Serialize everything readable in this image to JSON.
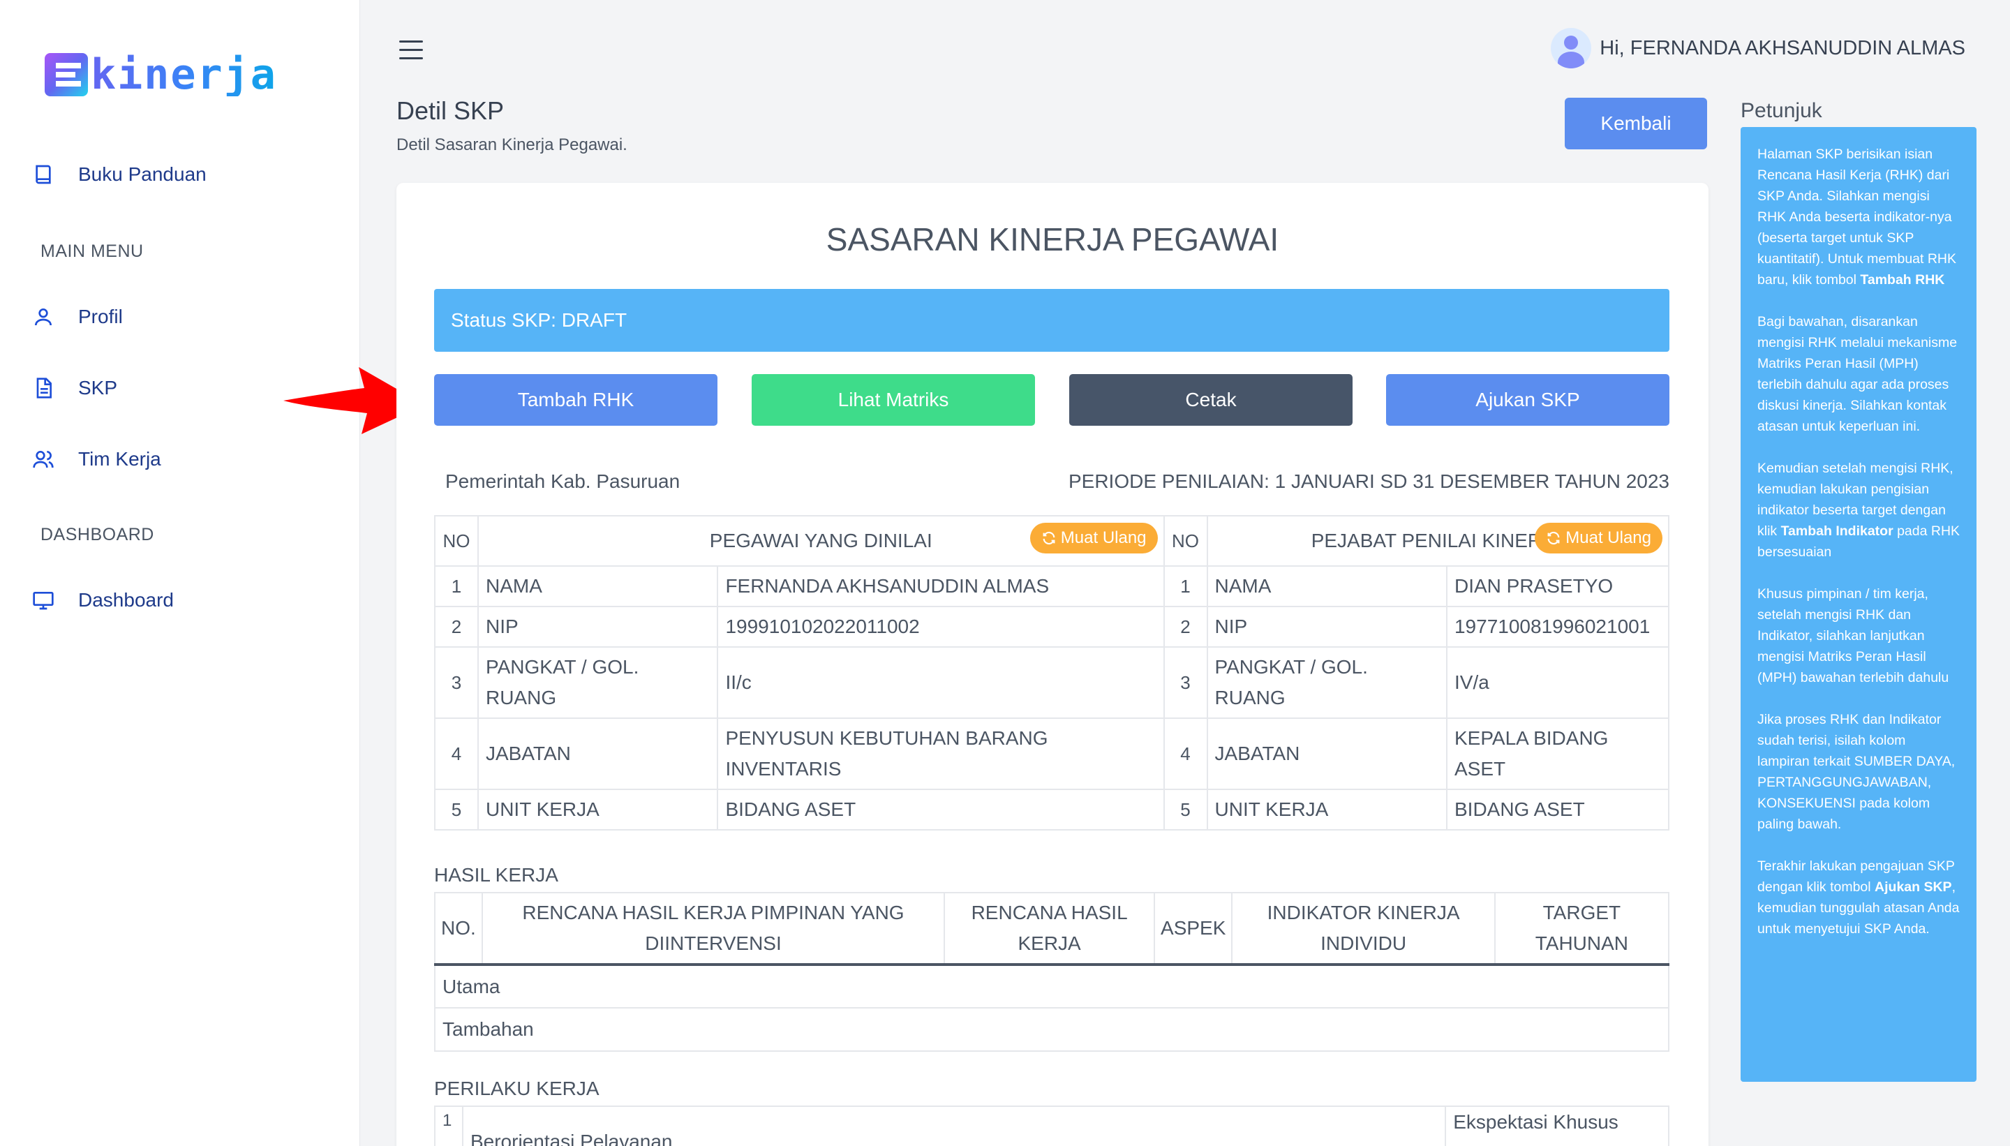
{
  "app": {
    "brand_letters": "kinerja"
  },
  "sidebar": {
    "items_top": [
      {
        "label": "Buku Panduan",
        "icon": "book-icon"
      }
    ],
    "section_main": "MAIN MENU",
    "items_main": [
      {
        "label": "Profil",
        "icon": "user-icon"
      },
      {
        "label": "SKP",
        "icon": "document-icon"
      },
      {
        "label": "Tim Kerja",
        "icon": "users-icon"
      }
    ],
    "section_dashboard": "DASHBOARD",
    "items_dashboard": [
      {
        "label": "Dashboard",
        "icon": "monitor-icon"
      }
    ]
  },
  "header": {
    "greeting": "Hi, FERNANDA AKHSANUDDIN ALMAS"
  },
  "page": {
    "title": "Detil SKP",
    "subtitle": "Detil Sasaran Kinerja Pegawai.",
    "back_label": "Kembali"
  },
  "card": {
    "title": "SASARAN KINERJA PEGAWAI",
    "status": "Status SKP: DRAFT",
    "actions": [
      {
        "label": "Tambah RHK",
        "color": "#5b8def"
      },
      {
        "label": "Lihat Matriks",
        "color": "#3edc8a"
      },
      {
        "label": "Cetak",
        "color": "#475569"
      },
      {
        "label": "Ajukan SKP",
        "color": "#5b8def"
      }
    ],
    "instansi": "Pemerintah Kab. Pasuruan",
    "periode": "PERIODE PENILAIAN: 1 JANUARI SD 31 DESEMBER TAHUN 2023"
  },
  "pegawai_table": {
    "no_header": "NO",
    "left_header": "PEGAWAI YANG DINILAI",
    "right_header": "PEJABAT PENILAI KINERJA",
    "reload_label": "Muat Ulang",
    "rows": [
      {
        "no": "1",
        "field": "NAMA",
        "left": "FERNANDA AKHSANUDDIN ALMAS",
        "right": "DIAN PRASETYO"
      },
      {
        "no": "2",
        "field": "NIP",
        "left": "199910102022011002",
        "right": "197710081996021001"
      },
      {
        "no": "3",
        "field": "PANGKAT / GOL. RUANG",
        "left": "II/c",
        "right": "IV/a"
      },
      {
        "no": "4",
        "field": "JABATAN",
        "left": "PENYUSUN KEBUTUHAN BARANG INVENTARIS",
        "right": "KEPALA BIDANG ASET"
      },
      {
        "no": "5",
        "field": "UNIT KERJA",
        "left": "BIDANG ASET",
        "right": "BIDANG ASET"
      }
    ]
  },
  "hasil_kerja": {
    "label": "HASIL KERJA",
    "headers": [
      "NO.",
      "RENCANA HASIL KERJA PIMPINAN YANG DIINTERVENSI",
      "RENCANA HASIL KERJA",
      "ASPEK",
      "INDIKATOR KINERJA INDIVIDU",
      "TARGET TAHUNAN"
    ],
    "groups": [
      "Utama",
      "Tambahan"
    ]
  },
  "perilaku_kerja": {
    "label": "PERILAKU KERJA",
    "rows": [
      {
        "no": "1",
        "text": "Berorientasi Pelayanan",
        "right": "Ekspektasi Khusus"
      }
    ]
  },
  "petunjuk": {
    "title": "Petunjuk",
    "p1_a": "Halaman SKP berisikan isian Rencana Hasil Kerja (RHK) dari SKP Anda. Silahkan mengisi RHK Anda beserta indikator-nya (beserta target untuk SKP kuantitatif). Untuk membuat RHK baru, klik tombol ",
    "p1_b": "Tambah RHK",
    "p2": "Bagi bawahan, disarankan mengisi RHK melalui mekanisme Matriks Peran Hasil (MPH) terlebih dahulu agar ada proses diskusi kinerja. Silahkan kontak atasan untuk keperluan ini.",
    "p3_a": "Kemudian setelah mengisi RHK, kemudian lakukan pengisian indikator beserta target dengan klik ",
    "p3_b": "Tambah Indikator",
    "p3_c": " pada RHK bersesuaian",
    "p4": "Khusus pimpinan / tim kerja, setelah mengisi RHK dan Indikator, silahkan lanjutkan mengisi Matriks Peran Hasil (MPH) bawahan terlebih dahulu",
    "p5": "Jika proses RHK dan Indikator sudah terisi, isilah kolom lampiran terkait SUMBER DAYA, PERTANGGUNGJAWABAN, KONSEKUENSI pada kolom paling bawah.",
    "p6_a": "Terakhir lakukan pengajuan SKP dengan klik tombol ",
    "p6_b": "Ajukan SKP",
    "p6_c": ", kemudian tunggulah atasan Anda untuk menyetujui SKP Anda."
  }
}
